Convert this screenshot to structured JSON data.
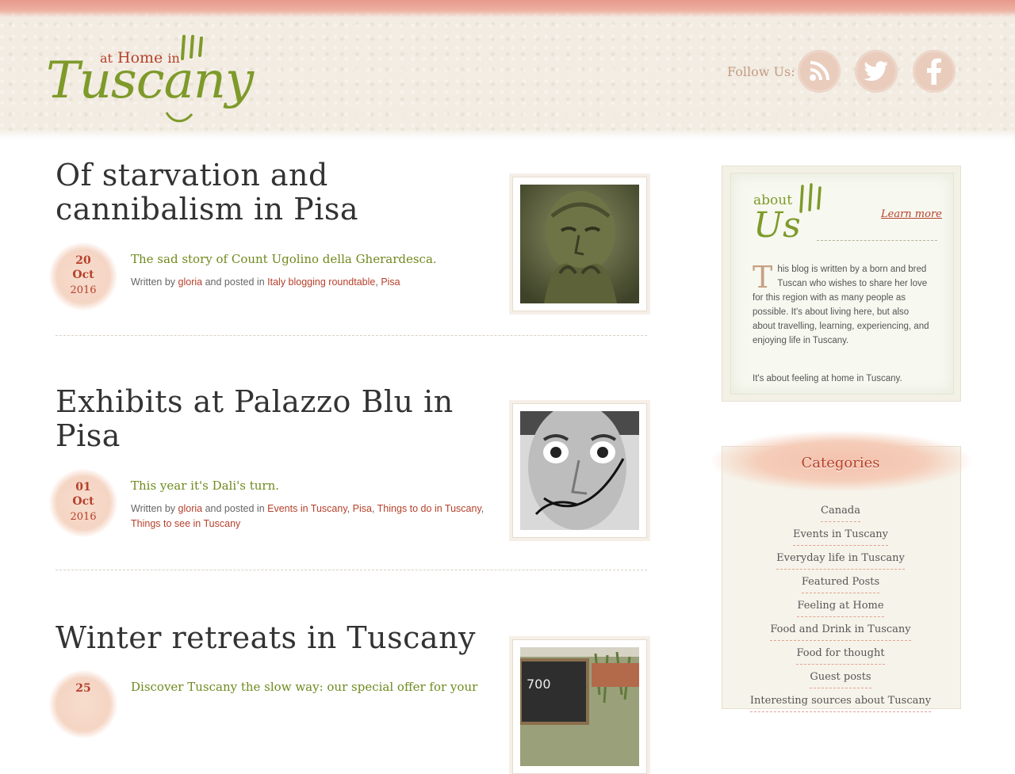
{
  "header": {
    "logo": {
      "at": "at",
      "home": "Home",
      "in": "in",
      "main": "Tuscany"
    },
    "follow_label": "Follow Us:",
    "social": [
      {
        "name": "rss-icon"
      },
      {
        "name": "twitter-icon"
      },
      {
        "name": "facebook-icon"
      }
    ],
    "colors": {
      "accent_green": "#7e9a2a",
      "accent_red": "#b5402a",
      "band": "#e79a8c"
    }
  },
  "posts": [
    {
      "title": "Of starvation and cannibalism in Pisa",
      "date": {
        "day": "20",
        "month": "Oct",
        "year": "2016"
      },
      "excerpt": "The sad story of Count Ugolino della Gherardesca.",
      "meta": {
        "written_by": "Written by",
        "author": "gloria",
        "posted_in": "and posted in",
        "categories": [
          "Italy blogging roundtable",
          "Pisa"
        ]
      },
      "thumbnail": "statue-photo"
    },
    {
      "title": "Exhibits at Palazzo Blu in Pisa",
      "date": {
        "day": "01",
        "month": "Oct",
        "year": "2016"
      },
      "excerpt": "This year it's Dali's turn.",
      "meta": {
        "written_by": "Written by",
        "author": "gloria",
        "posted_in": "and posted in",
        "categories": [
          "Events in Tuscany",
          "Pisa",
          "Things to do in Tuscany",
          "Things to see in Tuscany"
        ]
      },
      "thumbnail": "dali-portrait-photo"
    },
    {
      "title": "Winter retreats in Tuscany",
      "date": {
        "day": "25"
      },
      "excerpt": "Discover Tuscany the slow way: our special offer for your",
      "thumbnail": "chalkboard-photo"
    }
  ],
  "sidebar": {
    "about": {
      "about_word": "about",
      "us_word": "Us",
      "learn_more": "Learn more",
      "dropcap": "T",
      "text": "his blog is written by a born and bred Tuscan who wishes to share her love for this region with as many people as possible. It's about living here, but also about travelling, learning, experiencing, and enjoying life in Tuscany.",
      "text2": "It's about feeling at home in Tuscany."
    },
    "categories": {
      "title": "Categories",
      "items": [
        "Canada",
        "Events in Tuscany",
        "Everyday life in Tuscany",
        "Featured Posts",
        "Feeling at Home",
        "Food and Drink in Tuscany",
        "Food for thought",
        "Guest posts",
        "Interesting sources about Tuscany"
      ]
    }
  }
}
